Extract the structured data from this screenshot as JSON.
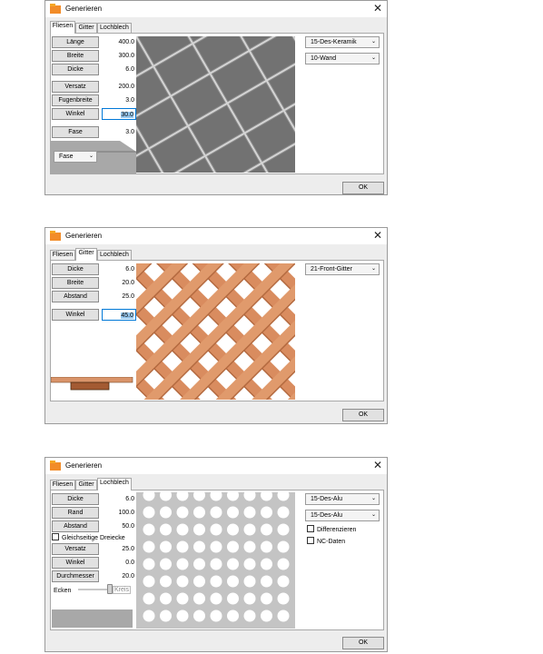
{
  "dialogs": [
    {
      "title": "Generieren",
      "tabs": [
        "Fliesen",
        "Gitter",
        "Lochblech"
      ],
      "active_tab": "Fliesen",
      "params": [
        {
          "label": "Länge",
          "value": "400.0"
        },
        {
          "label": "Breite",
          "value": "300.0"
        },
        {
          "label": "Dicke",
          "value": "6.0"
        },
        {
          "label": "Versatz",
          "value": "200.0"
        },
        {
          "label": "Fugenbreite",
          "value": "3.0"
        },
        {
          "label": "Winkel",
          "value": "30.0"
        },
        {
          "label": "Fase",
          "value": "3.0"
        }
      ],
      "profile_select": "Fase",
      "material_select": "15-Des-Keramik",
      "layer_select": "10-Wand",
      "ok_label": "OK"
    },
    {
      "title": "Generieren",
      "tabs": [
        "Fliesen",
        "Gitter",
        "Lochblech"
      ],
      "active_tab": "Gitter",
      "params": [
        {
          "label": "Dicke",
          "value": "6.0"
        },
        {
          "label": "Breite",
          "value": "20.0"
        },
        {
          "label": "Abstand",
          "value": "25.0"
        },
        {
          "label": "Winkel",
          "value": "45.0"
        }
      ],
      "material_select": "21-Front-Gitter",
      "ok_label": "OK"
    },
    {
      "title": "Generieren",
      "tabs": [
        "Fliesen",
        "Gitter",
        "Lochblech"
      ],
      "active_tab": "Lochblech",
      "params": [
        {
          "label": "Dicke",
          "value": "6.0"
        },
        {
          "label": "Rand",
          "value": "100.0"
        },
        {
          "label": "Abstand",
          "value": "50.0"
        },
        {
          "label": "Versatz",
          "value": "25.0"
        },
        {
          "label": "Winkel",
          "value": "0.0"
        },
        {
          "label": "Durchmesser",
          "value": "20.0"
        }
      ],
      "triangle_checkbox": "Gleichseitige Dreiecke",
      "corners_label": "Ecken",
      "corners_end_label": "Kreis",
      "material_select": "15-Des-Alu",
      "layer_select": "15-Des-Alu",
      "checkboxes": [
        "Differenzieren",
        "NC-Daten"
      ],
      "ok_label": "OK"
    }
  ],
  "colors": {
    "accent": "#0078d7",
    "tile": "#6b6b6b",
    "grout": "#d4d4d4",
    "wood": "#d68b5e",
    "perforated": "#c4c4c4"
  }
}
